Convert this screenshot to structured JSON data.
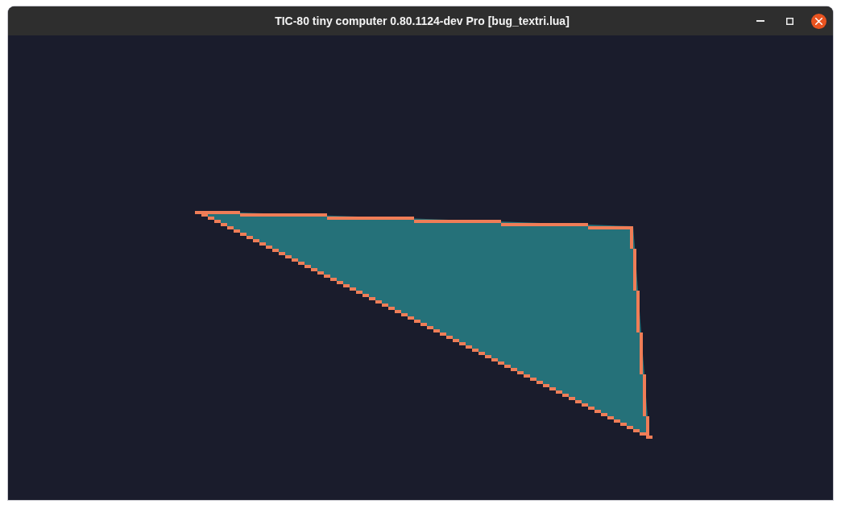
{
  "window": {
    "title": "TIC-80 tiny computer 0.80.1124-dev Pro [bug_textri.lua]"
  }
}
